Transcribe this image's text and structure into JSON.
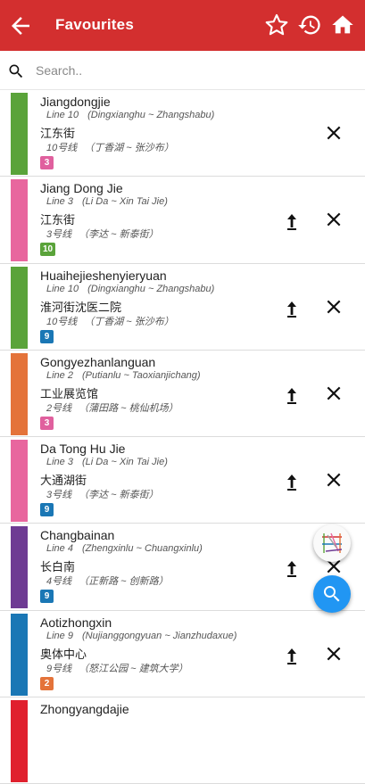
{
  "appbar": {
    "title": "Favourites",
    "color": "#d32f2f",
    "icons": [
      "back-arrow-icon",
      "star-outline-icon",
      "history-icon",
      "home-icon"
    ]
  },
  "search": {
    "placeholder": "Search..",
    "value": ""
  },
  "stations": [
    {
      "name_en": "Jiangdongjie",
      "line_en": "Line 10",
      "route_en": "(Dingxianghu ~ Zhangshabu)",
      "name_cn": "江东街",
      "line_cn": "10号线",
      "route_cn": "（丁香湖 ~ 张沙布）",
      "badge": "3",
      "badge_color": "#e0609e",
      "line_color": "#5aa33a",
      "show_up": false
    },
    {
      "name_en": "Jiang Dong Jie",
      "line_en": "Line 3",
      "route_en": "(Li Da ~ Xin Tai Jie)",
      "name_cn": "江东街",
      "line_cn": "3号线",
      "route_cn": "（李达 ~ 新泰街）",
      "badge": "10",
      "badge_color": "#5aa33a",
      "line_color": "#e8669e",
      "show_up": true
    },
    {
      "name_en": "Huaihejieshenyieryuan",
      "line_en": "Line 10",
      "route_en": "(Dingxianghu ~ Zhangshabu)",
      "name_cn": "淮河街沈医二院",
      "line_cn": "10号线",
      "route_cn": "（丁香湖 ~ 张沙布）",
      "badge": "9",
      "badge_color": "#1a77b5",
      "line_color": "#5aa33a",
      "show_up": true
    },
    {
      "name_en": "Gongyezhanlanguan",
      "line_en": "Line 2",
      "route_en": "(Putianlu ~ Taoxianjichang)",
      "name_cn": "工业展览馆",
      "line_cn": "2号线",
      "route_cn": "（蒲田路 ~ 桃仙机场）",
      "badge": "3",
      "badge_color": "#e0609e",
      "line_color": "#e4733a",
      "show_up": true
    },
    {
      "name_en": "Da Tong Hu Jie",
      "line_en": "Line 3",
      "route_en": "(Li Da ~ Xin Tai Jie)",
      "name_cn": "大通湖街",
      "line_cn": "3号线",
      "route_cn": "（李达 ~ 新泰街）",
      "badge": "9",
      "badge_color": "#1a77b5",
      "line_color": "#e8669e",
      "show_up": true
    },
    {
      "name_en": "Changbainan",
      "line_en": "Line 4",
      "route_en": "(Zhengxinlu ~ Chuangxinlu)",
      "name_cn": "长白南",
      "line_cn": "4号线",
      "route_cn": "（正新路 ~ 创新路）",
      "badge": "9",
      "badge_color": "#1a77b5",
      "line_color": "#6e3b93",
      "show_up": true
    },
    {
      "name_en": "Aotizhongxin",
      "line_en": "Line 9",
      "route_en": "(Nujianggongyuan ~ Jianzhudaxue)",
      "name_cn": "奥体中心",
      "line_cn": "9号线",
      "route_cn": "（怒江公园 ~ 建筑大学）",
      "badge": "2",
      "badge_color": "#e4733a",
      "line_color": "#1a77b5",
      "show_up": true
    },
    {
      "name_en": "Zhongyangdajie",
      "line_en": "",
      "route_en": "",
      "name_cn": "",
      "line_cn": "",
      "route_cn": "",
      "badge": "",
      "badge_color": "#d32f2f",
      "line_color": "#e0202e",
      "show_up": false
    }
  ],
  "fabs": {
    "map_icon": "metro-map-icon",
    "search_icon": "search-icon",
    "search_color": "#2196f3"
  }
}
